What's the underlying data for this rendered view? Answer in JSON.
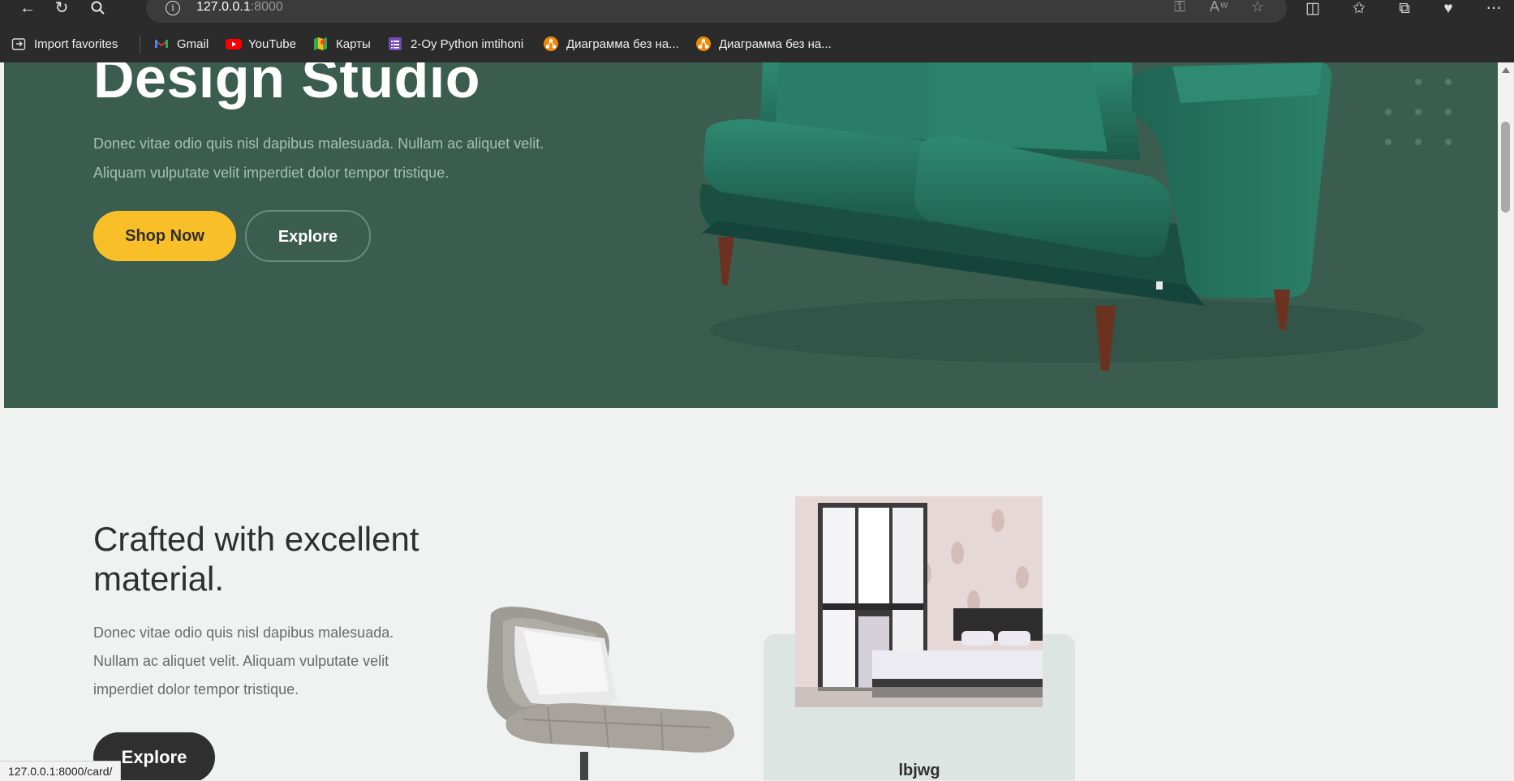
{
  "browser": {
    "url_host": "127.0.0.1",
    "url_port": ":8000",
    "bookmarks": [
      {
        "label": "Import favorites",
        "icon": "import-icon"
      },
      {
        "label": "Gmail",
        "icon": "gmail-icon"
      },
      {
        "label": "YouTube",
        "icon": "youtube-icon"
      },
      {
        "label": "Карты",
        "icon": "maps-icon"
      },
      {
        "label": "2-Oy Python imtihoni",
        "icon": "forms-icon"
      },
      {
        "label": "Диаграмма без на...",
        "icon": "diagram-icon"
      },
      {
        "label": "Диаграмма без на...",
        "icon": "diagram-icon"
      }
    ],
    "status_url": "127.0.0.1:8000/card/"
  },
  "hero": {
    "title": "Design Studio",
    "text": "Donec vitae odio quis nisl dapibus malesuada. Nullam ac aliquet velit. Aliquam vulputate velit imperdiet dolor tempor tristique.",
    "shop_label": "Shop Now",
    "explore_label": "Explore",
    "bg_color": "#3b5d50",
    "accent_color": "#f9bf29"
  },
  "section2": {
    "title": "Crafted with excellent material.",
    "text": "Donec vitae odio quis nisl dapibus malesuada. Nullam ac aliquet velit. Aliquam vulputate velit imperdiet dolor tempor tristique.",
    "explore_label": "Explore",
    "card_title": "lbjwg"
  }
}
